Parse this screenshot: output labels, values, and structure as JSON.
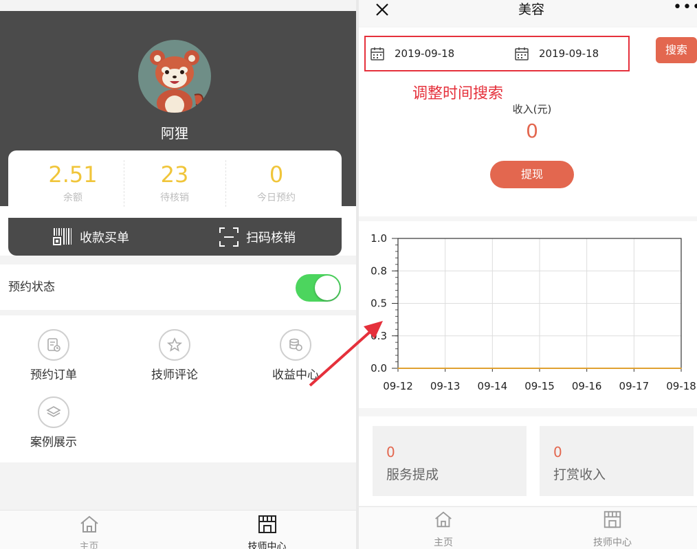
{
  "left": {
    "user_name": "阿狸",
    "stats": [
      {
        "value": "2.51",
        "label": "余额"
      },
      {
        "value": "23",
        "label": "待核销"
      },
      {
        "value": "0",
        "label": "今日预约"
      }
    ],
    "actions": {
      "collect_label": "收款买单",
      "scan_label": "扫码核销"
    },
    "appointment_status_label": "预约状态",
    "appointment_status_on": true,
    "grid": [
      {
        "label": "预约订单",
        "icon": "order-icon"
      },
      {
        "label": "技师评论",
        "icon": "star-icon"
      },
      {
        "label": "收益中心",
        "icon": "coins-icon"
      },
      {
        "label": "案例展示",
        "icon": "layers-icon"
      }
    ],
    "tabbar": [
      {
        "label": "主页",
        "icon": "home-icon",
        "active": false
      },
      {
        "label": "技师中心",
        "icon": "shop-icon",
        "active": true
      }
    ]
  },
  "right": {
    "nav_title": "美容",
    "nav_more": "•••",
    "start_date": "2019-09-18",
    "end_date": "2019-09-18",
    "search_label": "搜索",
    "annotation": "调整时间搜索",
    "income_label": "收入(元)",
    "income_value": "0",
    "withdraw_label": "提现",
    "cards": [
      {
        "value": "0",
        "label": "服务提成"
      },
      {
        "value": "0",
        "label": "打赏收入"
      }
    ],
    "tabbar": [
      {
        "label": "主页",
        "icon": "home-icon"
      },
      {
        "label": "技师中心",
        "icon": "shop-icon"
      }
    ]
  },
  "colors": {
    "accent": "#e3674f",
    "stat_yellow": "#f0c53a",
    "toggle_green": "#4cd55e",
    "annotation_red": "#e5303b",
    "hero_dark": "#4b4b4b"
  },
  "chart_data": {
    "type": "line",
    "x": [
      "09-12",
      "09-13",
      "09-14",
      "09-15",
      "09-16",
      "09-17",
      "09-18"
    ],
    "series": [
      {
        "values": [
          0,
          0,
          0,
          0,
          0,
          0,
          0
        ],
        "color": "#e0a030"
      }
    ],
    "y_ticks": [
      "1.0",
      "0.8",
      "0.5",
      "0.3",
      "0.0"
    ],
    "y_tick_values": [
      1.0,
      0.75,
      0.5,
      0.25,
      0.0
    ],
    "ylim": [
      0,
      1
    ],
    "grid": true,
    "title": "",
    "xlabel": "",
    "ylabel": ""
  }
}
